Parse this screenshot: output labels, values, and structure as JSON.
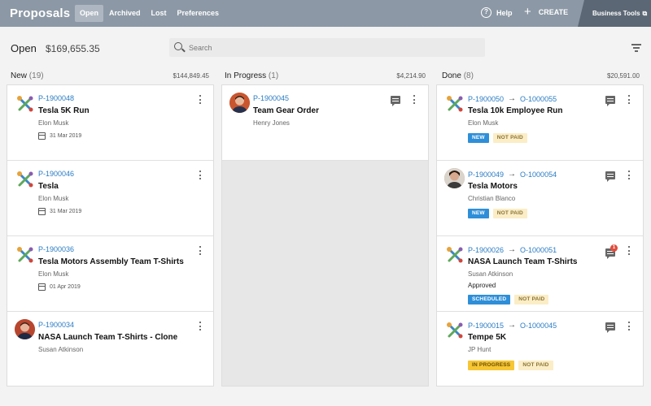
{
  "topbar": {
    "brand": "Proposals",
    "tabs": [
      {
        "label": "Open",
        "active": true
      },
      {
        "label": "Archived",
        "active": false
      },
      {
        "label": "Lost",
        "active": false
      },
      {
        "label": "Preferences",
        "active": false
      }
    ],
    "help_label": "Help",
    "help_glyph": "?",
    "create_label": "CREATE",
    "create_glyph": "+",
    "business_tools_label": "Business Tools",
    "external_glyph": "⧉"
  },
  "summary": {
    "title": "Open",
    "amount": "$169,655.35"
  },
  "search": {
    "placeholder": "Search",
    "value": ""
  },
  "columns": [
    {
      "name": "New",
      "count": "(19)",
      "total": "$144,849.45",
      "cards": [
        {
          "ids": [
            "P-1900048"
          ],
          "title": "Tesla 5K Run",
          "person": "Elon Musk",
          "date": "31 Mar 2019",
          "icon": "tools-icon"
        },
        {
          "ids": [
            "P-1900046"
          ],
          "title": "Tesla",
          "person": "Elon Musk",
          "date": "31 Mar 2019",
          "icon": "tools-icon"
        },
        {
          "ids": [
            "P-1900036"
          ],
          "title": "Tesla Motors Assembly Team T-Shirts",
          "person": "Elon Musk",
          "date": "01 Apr 2019",
          "icon": "tools-icon"
        },
        {
          "ids": [
            "P-1900034"
          ],
          "title": "NASA Launch Team T-Shirts - Clone",
          "person": "Susan Atkinson",
          "icon": "avatar"
        }
      ]
    },
    {
      "name": "In Progress",
      "count": "(1)",
      "total": "$4,214.90",
      "cards": [
        {
          "ids": [
            "P-1900045"
          ],
          "title": "Team Gear Order",
          "person": "Henry Jones",
          "icon": "avatar",
          "comment": true
        }
      ]
    },
    {
      "name": "Done",
      "count": "(8)",
      "total": "$20,591.00",
      "cards": [
        {
          "ids": [
            "P-1900050",
            "O-1000055"
          ],
          "title": "Tesla 10k Employee Run",
          "person": "Elon Musk",
          "badges": [
            {
              "label": "NEW",
              "style": "blue"
            },
            {
              "label": "NOT PAID",
              "style": "paid"
            }
          ],
          "icon": "tools-icon",
          "comment": true
        },
        {
          "ids": [
            "P-1900049",
            "O-1000054"
          ],
          "title": "Tesla Motors",
          "person": "Christian Blanco",
          "badges": [
            {
              "label": "NEW",
              "style": "blue"
            },
            {
              "label": "NOT PAID",
              "style": "paid"
            }
          ],
          "icon": "avatar",
          "comment": true
        },
        {
          "ids": [
            "P-1900026",
            "O-1000051"
          ],
          "title": "NASA Launch Team T-Shirts",
          "person": "Susan Atkinson",
          "status": "Approved",
          "badges": [
            {
              "label": "SCHEDULED",
              "style": "blue"
            },
            {
              "label": "NOT PAID",
              "style": "paid"
            }
          ],
          "icon": "tools-icon",
          "comment": true,
          "notification": "1"
        },
        {
          "ids": [
            "P-1900015",
            "O-1000045"
          ],
          "title": "Tempe 5K",
          "person": "JP Hunt",
          "badges": [
            {
              "label": "IN PROGRESS",
              "style": "yellow"
            },
            {
              "label": "NOT PAID",
              "style": "paid"
            }
          ],
          "icon": "tools-icon",
          "comment": true
        }
      ]
    }
  ],
  "colors": {
    "topbar": "#8c98a5",
    "business_tools": "#5b6774",
    "link": "#2a7cc4",
    "badge_blue": "#2e8fd8",
    "badge_yellow": "#f6c635",
    "badge_not_paid": "#fbedc6"
  },
  "icons": {
    "help": "help-circle-icon",
    "create": "plus-icon",
    "external": "external-link-icon",
    "search": "search-icon",
    "filter": "filter-icon",
    "menu": "kebab-menu-icon",
    "comment": "comment-icon",
    "date": "calendar-icon",
    "proposal": "tools-icon"
  }
}
